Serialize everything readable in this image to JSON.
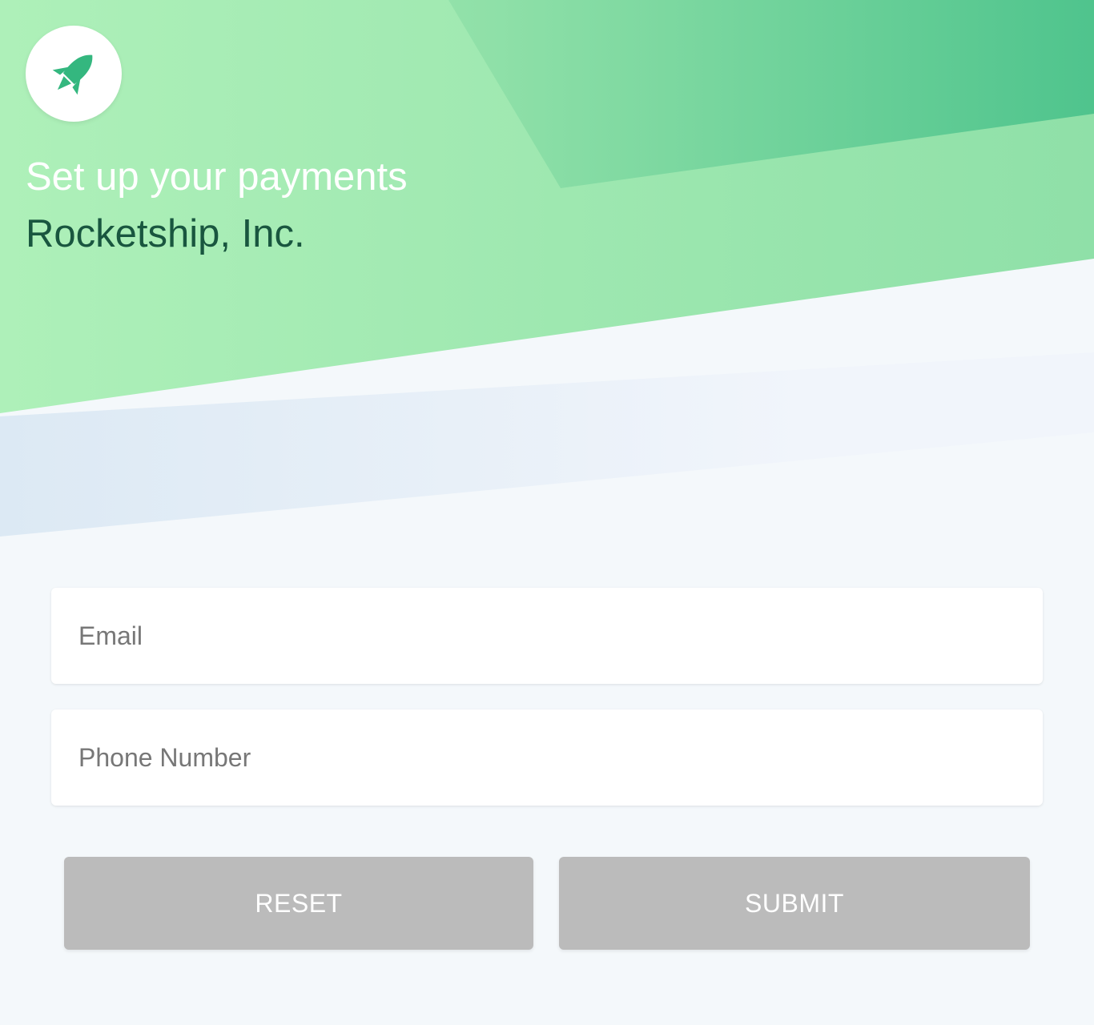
{
  "header": {
    "logo_icon": "rocket-icon",
    "title": "Set up your payments",
    "company": "Rocketship, Inc."
  },
  "form": {
    "email": {
      "placeholder": "Email",
      "value": ""
    },
    "phone": {
      "placeholder": "Phone Number",
      "value": ""
    }
  },
  "buttons": {
    "reset_label": "RESET",
    "submit_label": "SUBMIT"
  },
  "colors": {
    "accent": "#34b77f",
    "hero_light": "#aef0b9",
    "hero_dark": "#4fc48d",
    "company_text": "#19563f",
    "page_bg": "#f4f8fb",
    "button_bg": "#bbbbbb"
  }
}
